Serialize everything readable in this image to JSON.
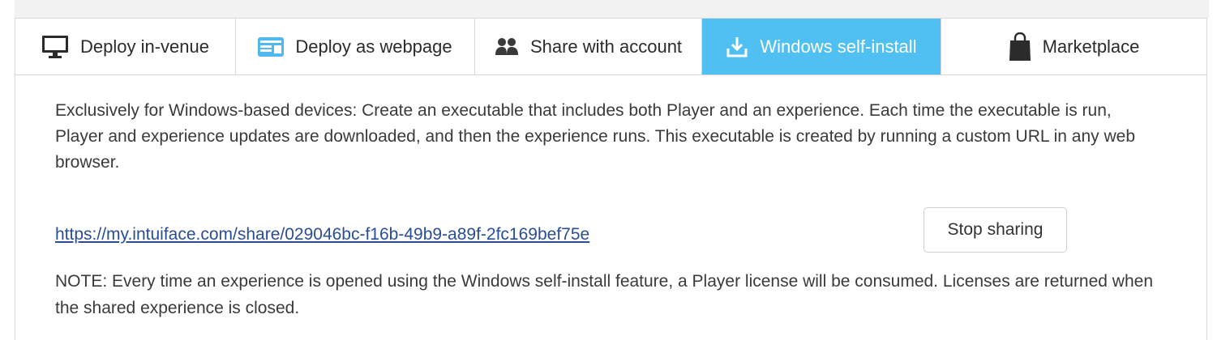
{
  "tabs": [
    {
      "label": "Deploy in-venue",
      "icon": "monitor-icon",
      "active": false
    },
    {
      "label": "Deploy as webpage",
      "icon": "webpage-icon",
      "active": false
    },
    {
      "label": "Share with account",
      "icon": "users-icon",
      "active": false
    },
    {
      "label": "Windows self-install",
      "icon": "download-icon",
      "active": true
    },
    {
      "label": "Marketplace",
      "icon": "shopping-bag-icon",
      "active": false
    }
  ],
  "main": {
    "description": "Exclusively for Windows-based devices: Create an executable that includes both Player and an experience. Each time the executable is run, Player and experience updates are downloaded, and then the experience runs. This executable is created by running a custom URL in any web browser.",
    "share_url": "https://my.intuiface.com/share/029046bc-f16b-49b9-a89f-2fc169bef75e",
    "stop_sharing_label": "Stop sharing",
    "note": "NOTE: Every time an experience is opened using the Windows self-install feature, a Player license will be consumed. Licenses are returned when the shared experience is closed."
  },
  "colors": {
    "active_tab": "#50c0f2",
    "link": "#2a4e96",
    "border": "#d9d9d9"
  }
}
